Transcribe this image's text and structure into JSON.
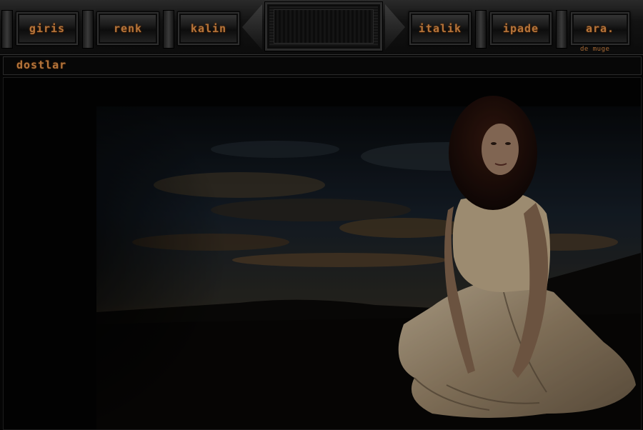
{
  "nav": {
    "left_items": [
      {
        "label": "giris"
      },
      {
        "label": "renk"
      },
      {
        "label": "kalin"
      }
    ],
    "right_items": [
      {
        "label": "italik"
      },
      {
        "label": "ipade"
      },
      {
        "label": "ara."
      }
    ],
    "credit": "de muge"
  },
  "subbar": {
    "label": "dostlar"
  },
  "colors": {
    "accent": "#b5743a",
    "background": "#050505"
  }
}
